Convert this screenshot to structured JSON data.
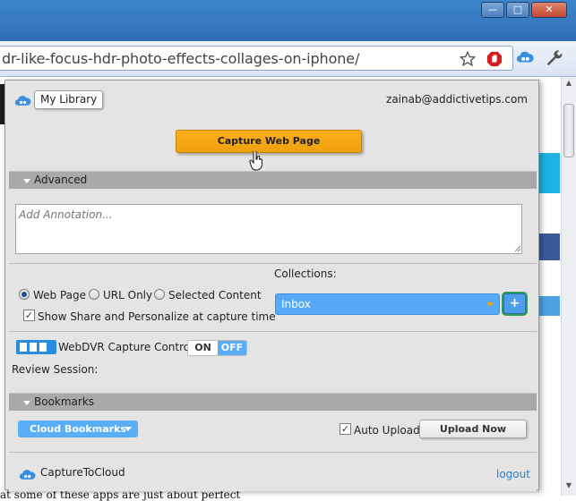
{
  "browser": {
    "url": "dr-like-focus-hdr-photo-effects-collages-on-iphone/",
    "window_buttons": [
      "minimize",
      "maximize",
      "close"
    ],
    "toolbar_icons": [
      "star-icon",
      "adblock-icon",
      "capturetocloud-icon",
      "wrench-icon"
    ]
  },
  "background_page": {
    "partial_text": "at some of these apps are just about perfect"
  },
  "popup": {
    "header": {
      "library_button": "My Library",
      "email": "zainab@addictivetips.com"
    },
    "capture_button": "Capture Web Page",
    "advanced": {
      "title": "Advanced",
      "annotation_placeholder": "Add Annotation...",
      "capture_options": [
        "Web Page",
        "URL Only",
        "Selected Content"
      ],
      "selected_option": "Web Page",
      "show_share_label": "Show Share and Personalize at capture time",
      "show_share_checked": true,
      "collections_label": "Collections:",
      "collection_value": "Inbox",
      "add_collection": "+"
    },
    "webdvr": {
      "label": "WebDVR Capture Control",
      "toggle_on": "ON",
      "toggle_off": "OFF",
      "state": "OFF",
      "review_session_label": "Review Session:"
    },
    "bookmarks": {
      "title": "Bookmarks",
      "dropdown": "Cloud Bookmarks",
      "auto_upload_label": "Auto Upload",
      "auto_upload_checked": true,
      "upload_button": "Upload Now"
    },
    "footer": {
      "brand": "CaptureToCloud",
      "logout": "logout"
    }
  },
  "colors": {
    "accent_orange": "#f0a00c",
    "accent_blue": "#55a9f6",
    "popup_bg": "#e4e4e4",
    "section_bar": "#a9a9a9",
    "link": "#2f7fd2"
  }
}
